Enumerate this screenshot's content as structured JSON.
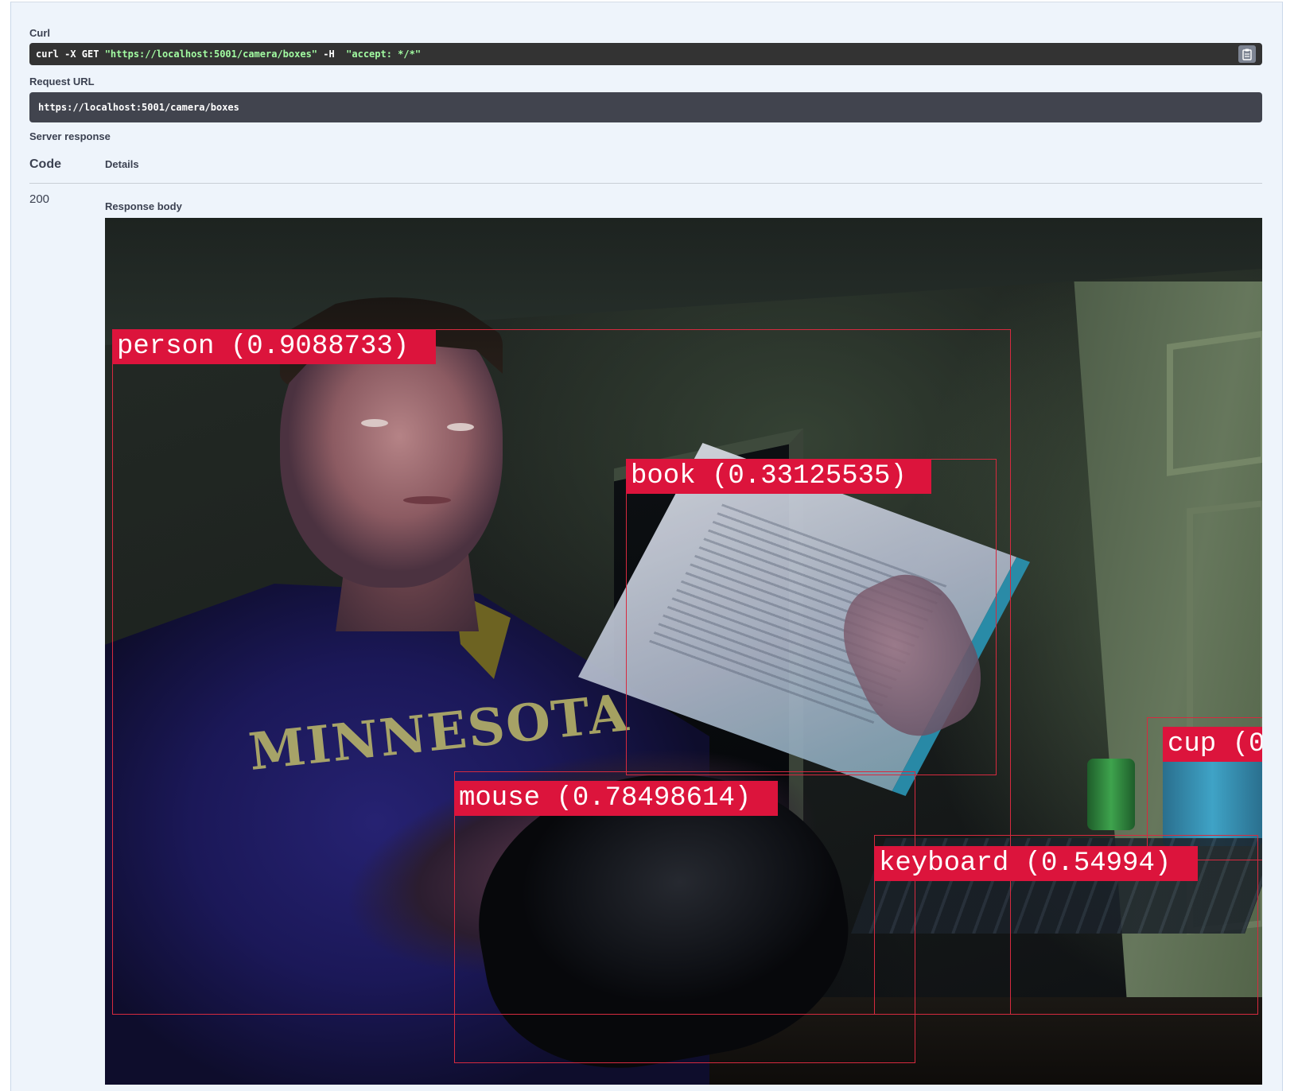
{
  "curl": {
    "label": "Curl",
    "cmd_prefix": "curl -X GET ",
    "cmd_url": "\"https://localhost:5001/camera/boxes\"",
    "cmd_mid": " -H  ",
    "cmd_header": "\"accept: */*\"",
    "copy_icon": "clipboard-icon"
  },
  "request_url": {
    "label": "Request URL",
    "value": "https://localhost:5001/camera/boxes"
  },
  "server_response": {
    "label": "Server response",
    "code_header": "Code",
    "details_header": "Details",
    "status_code": "200",
    "body_label": "Response body"
  },
  "detections": [
    {
      "label": "person (0.9088733)",
      "object": "person",
      "confidence": 0.9088733
    },
    {
      "label": "book (0.33125535)",
      "object": "book",
      "confidence": 0.33125535
    },
    {
      "label": "mouse (0.78498614)",
      "object": "mouse",
      "confidence": 0.78498614
    },
    {
      "label": "keyboard (0.54994)",
      "object": "keyboard",
      "confidence": 0.54994
    },
    {
      "label": "cup (0",
      "object": "cup"
    }
  ],
  "colors": {
    "panel_bg": "#eef4fb",
    "code_bg": "#333333",
    "url_bg": "#41444e",
    "string_green": "#a2fca2",
    "detection_red": "#dc143c"
  }
}
